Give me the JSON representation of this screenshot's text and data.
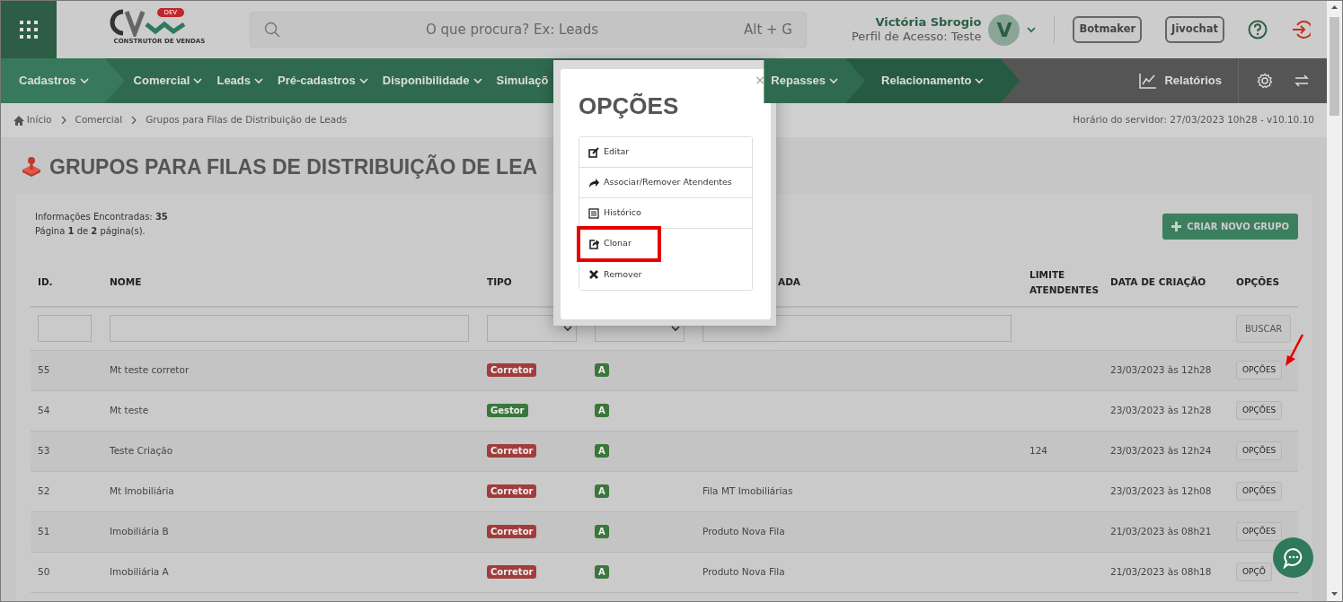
{
  "header": {
    "logo_tag": "DEV",
    "logo_caption": "CONSTRUTOR DE VENDAS",
    "search": {
      "placeholder": "O que procura? Ex: Leads",
      "shortcut": "Alt + G"
    },
    "user": {
      "name": "Victória Sbrogio",
      "profile": "Perfil de Acesso: Teste",
      "initial": "V"
    },
    "buttons": [
      "Botmaker",
      "Jivochat"
    ]
  },
  "nav": {
    "items": [
      {
        "label": "Cadastros",
        "kind": "start"
      },
      {
        "label": "Comercial",
        "kind": "plain"
      },
      {
        "label": "Leads",
        "kind": "plain"
      },
      {
        "label": "Pré-cadastros",
        "kind": "plain"
      },
      {
        "label": "Disponibilidade",
        "kind": "plain"
      },
      {
        "label": "Simulaçõ",
        "kind": "cut"
      },
      {
        "label": "Repasses",
        "kind": "plain"
      },
      {
        "label": "Relacionamento",
        "kind": "end"
      }
    ],
    "reports": "Relatórios"
  },
  "breadcrumb": {
    "items": [
      "Início",
      "Comercial",
      "Grupos para Filas de Distribuição de Leads"
    ],
    "server_time": "Horário do servidor: 27/03/2023 10h28 - v10.10.10"
  },
  "page_title": "GRUPOS PARA FILAS DE DISTRIBUIÇÃO DE LEA",
  "summary": {
    "found": "Informações Encontradas: **35**",
    "pages": "Página **1** de **2** página(s)."
  },
  "create_button": "CRIAR NOVO GRUPO",
  "table": {
    "columns": [
      "ID.",
      "NOME",
      "TIPO",
      "ADA",
      "LIMITE ATENDENTES",
      "DATA DE CRIAÇÃO",
      "OPÇÕES"
    ],
    "filters": [
      {
        "kind": "input"
      },
      {
        "kind": "input"
      },
      {
        "kind": "select"
      },
      {
        "kind": "select"
      },
      {
        "kind": "input"
      },
      {
        "kind": "none"
      },
      {
        "kind": "none"
      },
      {
        "kind": "button",
        "label": "BUSCAR"
      }
    ],
    "rows": [
      {
        "id": "55",
        "nome": "Mt teste corretor",
        "tipo": {
          "text": "Corretor",
          "color": "#a23c3c"
        },
        "status": {
          "text": "A",
          "color": "#3b763b"
        },
        "data": "23/03/2023 às 12h28",
        "options": "OPÇÕES",
        "pointed": true
      },
      {
        "id": "54",
        "nome": "Mt teste",
        "tipo": {
          "text": "Gestor",
          "color": "#3b763b"
        },
        "status": {
          "text": "A",
          "color": "#3b763b"
        },
        "data": "23/03/2023 às 12h28",
        "options": "OPÇÕES",
        "pointed": false
      },
      {
        "id": "53",
        "nome": "Teste Criação",
        "tipo": {
          "text": "Corretor",
          "color": "#a23c3c"
        },
        "status": {
          "text": "A",
          "color": "#3b763b"
        },
        "limite": "124",
        "data": "23/03/2023 às 12h24",
        "options": "OPÇÕES",
        "pointed": false
      },
      {
        "id": "52",
        "nome": "Mt Imobiliária",
        "tipo": {
          "text": "Corretor",
          "color": "#a23c3c"
        },
        "status": {
          "text": "A",
          "color": "#3b763b"
        },
        "column_5": "Fila MT Imobiliárias",
        "data": "23/03/2023 às 12h08",
        "options": "OPÇÕES",
        "pointed": false
      },
      {
        "id": "51",
        "nome": "Imobiliária B",
        "tipo": {
          "text": "Corretor",
          "color": "#a23c3c"
        },
        "status": {
          "text": "A",
          "color": "#3b763b"
        },
        "column_5": "Produto Nova Fila",
        "data": "21/03/2023 às 08h21",
        "options": "OPÇÕES",
        "pointed": false
      },
      {
        "id": "50",
        "nome": "Imobiliária A",
        "tipo": {
          "text": "Corretor",
          "color": "#a23c3c"
        },
        "status": {
          "text": "A",
          "color": "#3b763b"
        },
        "column_5": "Produto Nova Fila",
        "data": "21/03/2023 às 08h18",
        "options": "OPÇÕ",
        "pointed": false
      }
    ]
  },
  "modal": {
    "title": "OPÇÕES",
    "close": "×",
    "items": [
      {
        "label": "Editar",
        "kind": "edit",
        "highlighted": false
      },
      {
        "label": "Associar/Remover Atendentes",
        "kind": "share",
        "highlighted": false
      },
      {
        "label": "Histórico",
        "kind": "list",
        "highlighted": false
      },
      {
        "label": "Clonar",
        "kind": "clone",
        "highlighted": true
      },
      {
        "label": "Remover",
        "kind": "remove",
        "highlighted": false
      }
    ]
  }
}
